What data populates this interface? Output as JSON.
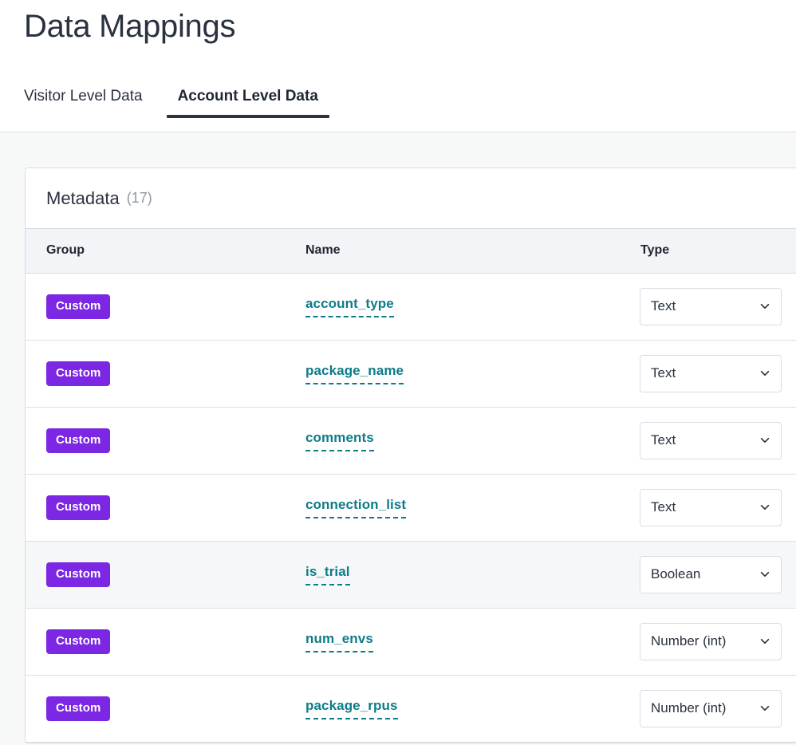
{
  "page": {
    "title": "Data Mappings"
  },
  "tabs": [
    {
      "label": "Visitor Level Data",
      "active": false
    },
    {
      "label": "Account Level Data",
      "active": true
    }
  ],
  "card": {
    "title": "Metadata",
    "count": "(17)",
    "columns": [
      "Group",
      "Name",
      "Type"
    ],
    "rows": [
      {
        "group": "Custom",
        "name": "account_type",
        "type": "Text",
        "highlighted": false
      },
      {
        "group": "Custom",
        "name": "package_name",
        "type": "Text",
        "highlighted": false
      },
      {
        "group": "Custom",
        "name": "comments",
        "type": "Text",
        "highlighted": false
      },
      {
        "group": "Custom",
        "name": "connection_list",
        "type": "Text",
        "highlighted": false
      },
      {
        "group": "Custom",
        "name": "is_trial",
        "type": "Boolean",
        "highlighted": true
      },
      {
        "group": "Custom",
        "name": "num_envs",
        "type": "Number (int)",
        "highlighted": false
      },
      {
        "group": "Custom",
        "name": "package_rpus",
        "type": "Number (int)",
        "highlighted": false
      }
    ]
  },
  "colors": {
    "badge_purple": "#7c27e3",
    "link_teal": "#0c7c89",
    "tab_underline": "#2a3342",
    "page_bg": "#f7f8f8",
    "border": "#d6dbe4"
  },
  "icons": {
    "chevron_down": "chevron-down-icon"
  }
}
